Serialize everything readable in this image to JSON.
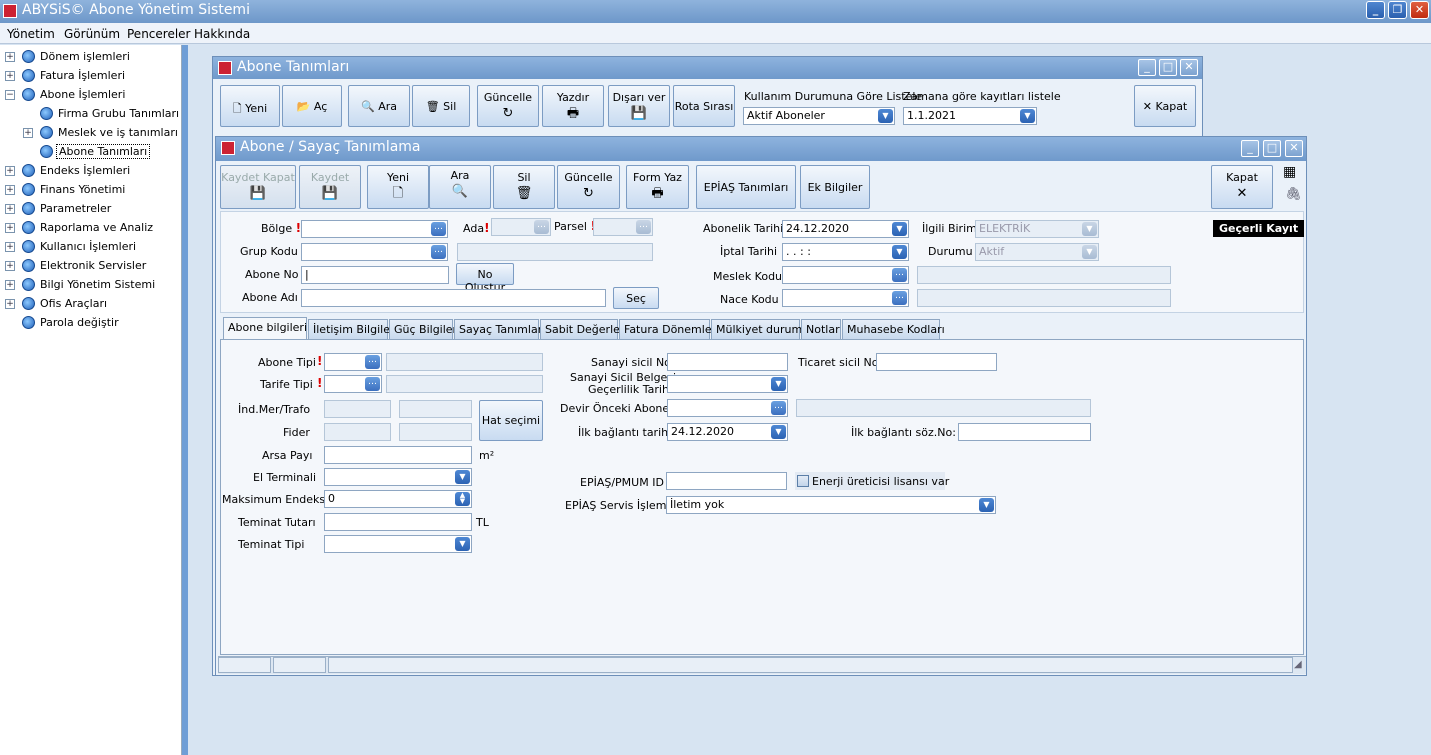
{
  "app": {
    "title": "ABYSiS© Abone Yönetim Sistemi"
  },
  "menu": [
    "Yönetim",
    "Görünüm",
    "Pencereler",
    "Hakkında"
  ],
  "sidebar": {
    "items": [
      {
        "label": "Dönem işlemleri"
      },
      {
        "label": "Fatura İşlemleri"
      },
      {
        "label": "Abone İşlemleri"
      },
      {
        "label": "Firma Grubu Tanımları"
      },
      {
        "label": "Meslek ve iş tanımları"
      },
      {
        "label": "Abone Tanımları"
      },
      {
        "label": "Endeks İşlemleri"
      },
      {
        "label": "Finans Yönetimi"
      },
      {
        "label": "Parametreler"
      },
      {
        "label": "Raporlama ve Analiz"
      },
      {
        "label": "Kullanıcı İşlemleri"
      },
      {
        "label": "Elektronik Servisler"
      },
      {
        "label": "Bilgi Yönetim Sistemi"
      },
      {
        "label": "Ofis Araçları"
      },
      {
        "label": "Parola değiştir"
      }
    ]
  },
  "win1": {
    "title": "Abone Tanımları",
    "buttons": {
      "yeni": "Yeni",
      "ac": "Aç",
      "ara": "Ara",
      "sil": "Sil",
      "guncelle": "Güncelle",
      "yazdir": "Yazdır",
      "disari": "Dışarı ver",
      "rota": "Rota Sırası",
      "kapat": "Kapat"
    },
    "filter1_label": "Kullanım Durumuna Göre Listele",
    "filter1_value": "Aktif Aboneler",
    "filter2_label": "Zamana göre kayıtları listele",
    "filter2_value": "1.1.2021"
  },
  "win2": {
    "title": "Abone / Sayaç Tanımlama",
    "buttons": {
      "kaydet_kapat": "Kaydet Kapat",
      "kaydet": "Kaydet",
      "yeni": "Yeni",
      "ara": "Ara",
      "sil": "Sil",
      "guncelle": "Güncelle",
      "form_yaz": "Form Yaz",
      "epias": "EPİAŞ Tanımları",
      "ek": "Ek Bilgiler",
      "kapat": "Kapat"
    },
    "status_badge": "Geçerli Kayıt",
    "header": {
      "bolge": "Bölge",
      "ada": "Ada",
      "parsel": "Parsel",
      "grup_kodu": "Grup Kodu",
      "abone_no": "Abone No",
      "no_olustur": "No Oluştur",
      "abone_adi": "Abone Adı",
      "sec": "Seç",
      "abonelik_tarihi": "Abonelik Tarihi",
      "abonelik_tarihi_value": "24.12.2020",
      "iptal_tarihi": "İptal Tarihi",
      "iptal_tarihi_value": ".  .     :  :",
      "meslek_kodu": "Meslek Kodu",
      "nace_kodu": "Nace Kodu",
      "ilgili_birim": "İlgili Birim",
      "ilgili_birim_value": "ELEKTRİK",
      "durumu": "Durumu",
      "durumu_value": "Aktif"
    },
    "tabs": [
      "Abone bilgileri",
      "İletişim Bilgileri",
      "Güç Bilgileri",
      "Sayaç Tanımları",
      "Sabit Değerler",
      "Fatura Dönemleri",
      "Mülkiyet durumu",
      "Notlar",
      "Muhasebe Kodları"
    ],
    "form": {
      "abone_tipi": "Abone Tipi",
      "tarife_tipi": "Tarife Tipi",
      "ind_mer": "İnd.Mer/Trafo",
      "fider": "Fider",
      "hat_secimi": "Hat seçimi",
      "arsa_payi": "Arsa Payı",
      "m2": "m²",
      "el_terminali": "El Terminali",
      "maks_endeks": "Maksimum Endeks",
      "maks_endeks_value": "0",
      "teminat_tutari": "Teminat Tutarı",
      "tl": "TL",
      "teminat_tipi": "Teminat Tipi",
      "sanayi_sicil": "Sanayi sicil No",
      "ticaret_sicil": "Ticaret sicil No",
      "sanayi_belge_1": "Sanayi Sicil Belgesi",
      "sanayi_belge_2": "Geçerlilik Tarihi",
      "devir": "Devir Önceki Abone",
      "ilk_baglanti": "İlk bağlantı tarihi",
      "ilk_baglanti_value": "24.12.2020",
      "ilk_baglanti_soz": "İlk bağlantı söz.No:",
      "epias_pmum": "EPİAŞ/PMUM ID",
      "enerji": "Enerji üreticisi lisansı var",
      "epias_servis": "EPİAŞ Servis İşlemi",
      "epias_servis_value": "İletim yok"
    }
  }
}
